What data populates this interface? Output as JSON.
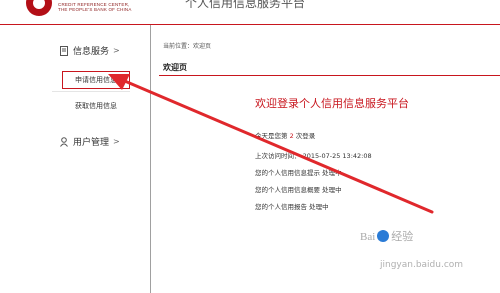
{
  "header": {
    "logo_lines": [
      "CREDIT REFERENCE CENTER,",
      "THE PEOPLE'S BANK OF CHINA"
    ],
    "title_partial": "个人信用信息服务平台"
  },
  "sidebar": {
    "info_service": {
      "label": "信息服务",
      "arrow": ">"
    },
    "apply_credit": "申请信用信息",
    "get_credit": "获取信用信息",
    "user_manage": {
      "label": "用户管理",
      "arrow": ">"
    }
  },
  "main": {
    "breadcrumb": "当前位置：欢迎页",
    "page_title": "欢迎页",
    "welcome": "欢迎登录个人信用信息服务平台",
    "today_prefix": "今天是您第",
    "today_count": "2",
    "today_suffix": "次登录",
    "last_visit_label": "上次访问时间：",
    "last_visit_time": "2015-07-25 13:42:08",
    "status_lines": [
      "您的个人信用信息提示  处理中",
      "您的个人信用信息概要  处理中",
      "您的个人信用报告  处理中"
    ]
  },
  "annotation": {
    "color": "#e0282c"
  },
  "watermark": {
    "brand": "Bai",
    "brand2": "经验",
    "url": "jingyan.baidu.com"
  }
}
